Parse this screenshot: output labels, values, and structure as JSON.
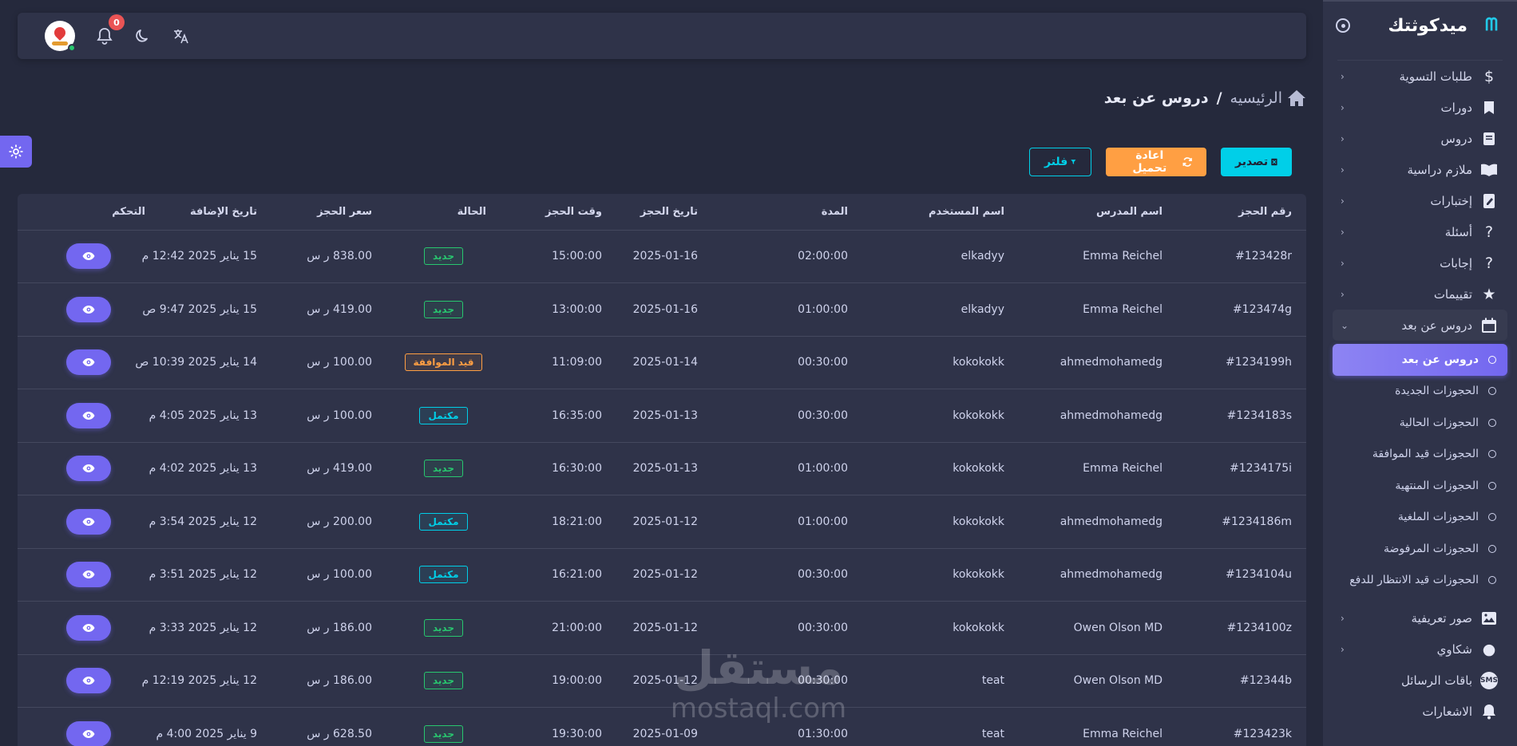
{
  "brand": {
    "name": "ميدكوثتك",
    "logo": "MQ-logo"
  },
  "navbar": {
    "notifications_count": "0"
  },
  "breadcrumb": {
    "home": "الرئيسيه",
    "separator": "/",
    "current": "دروس عن بعد"
  },
  "actions": {
    "export": "تصدير",
    "reload": "اعادة تحميل",
    "filter": "فلتر"
  },
  "sidebar": {
    "items": [
      {
        "label": "طلبات التسوية",
        "icon": "dollar-icon"
      },
      {
        "label": "دورات",
        "icon": "bookmark-icon"
      },
      {
        "label": "دروس",
        "icon": "book-icon"
      },
      {
        "label": "ملازم دراسية",
        "icon": "open-book-icon"
      },
      {
        "label": "إختبارات",
        "icon": "exam-icon"
      },
      {
        "label": "أسئلة",
        "icon": "question-icon"
      },
      {
        "label": "إجابات",
        "icon": "answer-icon"
      },
      {
        "label": "تقييمات",
        "icon": "star-icon"
      },
      {
        "label": "دروس عن بعد",
        "icon": "calendar-icon"
      }
    ],
    "subitems": [
      "دروس عن بعد",
      "الحجوزات الجديدة",
      "الحجوزات الحالية",
      "الحجوزات قيد الموافقة",
      "الحجوزات المنتهية",
      "الحجوزات الملغية",
      "الحجوزات المرفوضة",
      "الحجوزات قيد الانتظار للدفع"
    ],
    "bottom_items": [
      {
        "label": "صور تعريفية",
        "icon": "image-icon"
      },
      {
        "label": "شكاوي",
        "icon": "complaint-icon"
      },
      {
        "label": "باقات الرسائل",
        "icon": "sms-icon"
      },
      {
        "label": "الاشعارات",
        "icon": "bell-icon"
      }
    ]
  },
  "table": {
    "headers": [
      "رقم الحجز",
      "اسم المدرس",
      "اسم المستخدم",
      "المدة",
      "تاريخ الحجز",
      "وقت الحجز",
      "الحالة",
      "سعر الحجز",
      "تاريخ الإضافة",
      "التحكم"
    ],
    "rows": [
      {
        "id": "#123428r",
        "teacher": "Emma Reichel",
        "user": "elkadyy",
        "duration": "02:00:00",
        "date": "2025-01-16",
        "time": "15:00:00",
        "status": "جديد",
        "status_type": "new",
        "price": "838.00 ر س",
        "added": "15 يناير 2025 12:42 م"
      },
      {
        "id": "#123474g",
        "teacher": "Emma Reichel",
        "user": "elkadyy",
        "duration": "01:00:00",
        "date": "2025-01-16",
        "time": "13:00:00",
        "status": "جديد",
        "status_type": "new",
        "price": "419.00 ر س",
        "added": "15 يناير 2025 9:47 ص"
      },
      {
        "id": "#1234199h",
        "teacher": "ahmedmohamedg",
        "user": "kokokokk",
        "duration": "00:30:00",
        "date": "2025-01-14",
        "time": "11:09:00",
        "status": "قيد الموافقة",
        "status_type": "pending",
        "price": "100.00 ر س",
        "added": "14 يناير 2025 10:39 ص"
      },
      {
        "id": "#1234183s",
        "teacher": "ahmedmohamedg",
        "user": "kokokokk",
        "duration": "00:30:00",
        "date": "2025-01-13",
        "time": "16:35:00",
        "status": "مكتمل",
        "status_type": "done",
        "price": "100.00 ر س",
        "added": "13 يناير 2025 4:05 م"
      },
      {
        "id": "#1234175i",
        "teacher": "Emma Reichel",
        "user": "kokokokk",
        "duration": "01:00:00",
        "date": "2025-01-13",
        "time": "16:30:00",
        "status": "جديد",
        "status_type": "new",
        "price": "419.00 ر س",
        "added": "13 يناير 2025 4:02 م"
      },
      {
        "id": "#1234186m",
        "teacher": "ahmedmohamedg",
        "user": "kokokokk",
        "duration": "01:00:00",
        "date": "2025-01-12",
        "time": "18:21:00",
        "status": "مكتمل",
        "status_type": "done",
        "price": "200.00 ر س",
        "added": "12 يناير 2025 3:54 م"
      },
      {
        "id": "#1234104u",
        "teacher": "ahmedmohamedg",
        "user": "kokokokk",
        "duration": "00:30:00",
        "date": "2025-01-12",
        "time": "16:21:00",
        "status": "مكتمل",
        "status_type": "done",
        "price": "100.00 ر س",
        "added": "12 يناير 2025 3:51 م"
      },
      {
        "id": "#1234100z",
        "teacher": "Owen Olson MD",
        "user": "kokokokk",
        "duration": "00:30:00",
        "date": "2025-01-12",
        "time": "21:00:00",
        "status": "جديد",
        "status_type": "new",
        "price": "186.00 ر س",
        "added": "12 يناير 2025 3:33 م"
      },
      {
        "id": "#12344b",
        "teacher": "Owen Olson MD",
        "user": "teat",
        "duration": "00:30:00",
        "date": "2025-01-12",
        "time": "19:00:00",
        "status": "جديد",
        "status_type": "new",
        "price": "186.00 ر س",
        "added": "12 يناير 2025 12:19 م"
      },
      {
        "id": "#123423k",
        "teacher": "Emma Reichel",
        "user": "teat",
        "duration": "01:30:00",
        "date": "2025-01-09",
        "time": "19:30:00",
        "status": "جديد",
        "status_type": "new",
        "price": "628.50 ر س",
        "added": "9 يناير 2025 4:00 م"
      }
    ]
  },
  "watermark": {
    "line1": "مستقل",
    "line2": "mostaql.com"
  },
  "colors": {
    "primary": "#7367f0",
    "info": "#00cfe8",
    "warning": "#ff9f43",
    "success": "#28c76f",
    "danger": "#ea5455",
    "bg": "#25293c",
    "card": "#2f3349"
  }
}
